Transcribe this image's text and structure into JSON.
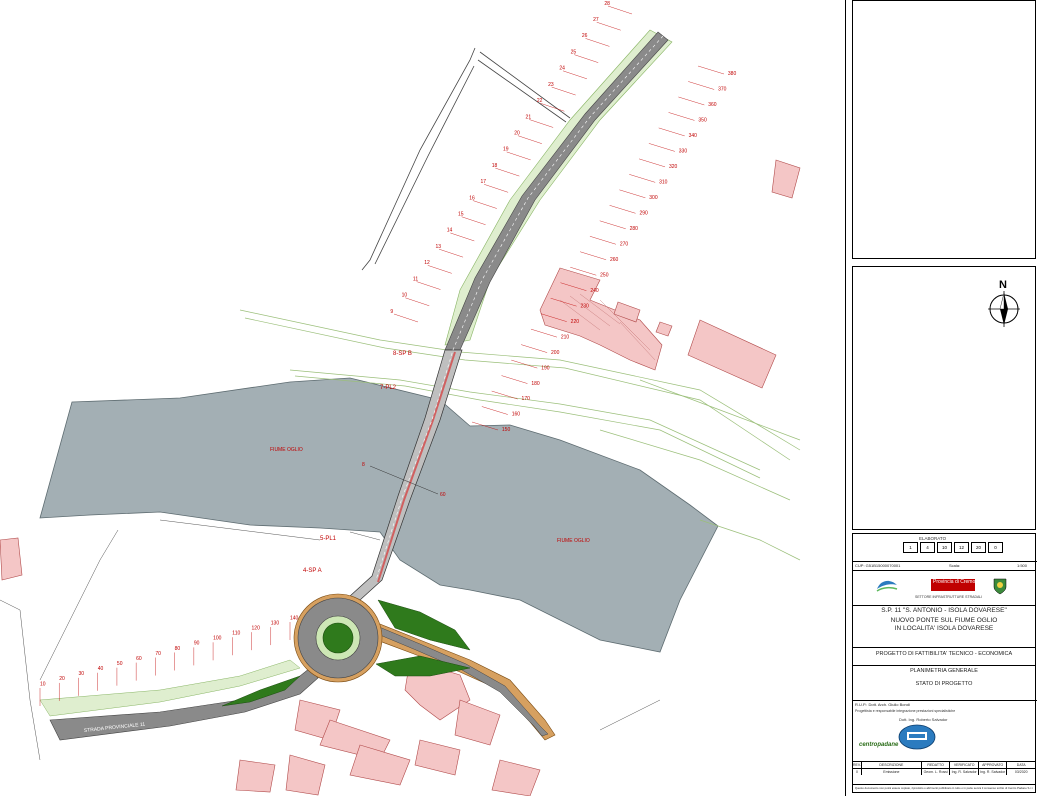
{
  "map": {
    "river_label_1": "FIUME OGLIO",
    "river_label_2": "FIUME OGLIO",
    "road_label": "STRADA PROVINCIALE 11",
    "section_labels": [
      "8-SP B",
      "7-PL2",
      "5-PL1",
      "4-SP A"
    ],
    "center_numbers": [
      "8",
      "60"
    ],
    "left_stations": [
      "28",
      "27",
      "26",
      "25",
      "24",
      "23",
      "22",
      "21",
      "20",
      "19",
      "18",
      "17",
      "16",
      "15",
      "14",
      "13",
      "12",
      "11",
      "10",
      "9"
    ],
    "right_stations": [
      "380",
      "370",
      "360",
      "350",
      "340",
      "330",
      "320",
      "310",
      "300",
      "290",
      "280",
      "270",
      "260",
      "250",
      "240",
      "230",
      "220",
      "210",
      "200",
      "190",
      "180",
      "170",
      "160",
      "150"
    ],
    "bottom_stations": [
      "10",
      "20",
      "30",
      "40",
      "50",
      "60",
      "70",
      "80",
      "90",
      "100",
      "110",
      "120",
      "130",
      "140"
    ]
  },
  "panel": {
    "north_label": "N",
    "sheet_header": "ELABORATO",
    "sheet_cells": [
      "1",
      "4",
      "10",
      "12",
      "20",
      "0"
    ],
    "cup_label": "CUP: G51B15000070001",
    "scale_label": "Scala:",
    "scale_value": "1:500",
    "logo_provincia": "Provincia di Cremona",
    "settore_text": "SETTORE INFRASTRUTTURE STRADALI",
    "road_title": "S.P. 11 \"S. ANTONIO - ISOLA DOVARESE\"",
    "project_title_1": "NUOVO PONTE SUL FIUME OGLIO",
    "project_title_2": "IN LOCALITA' ISOLA DOVARESE",
    "phase": "PROGETTO DI FATTIBILITA' TECNICO - ECONOMICA",
    "drawing_1": "PLANIMETRIA GENERALE",
    "drawing_2": "STATO DI PROGETTO",
    "rup": "R.U.P.: Dott. Arch. Giulio Bondi",
    "progettista": "Progettista e responsabile integrazione prestazioni specialistiche",
    "engineer": "Dott. Ing. Roberto Salvador",
    "company_logo": "centropadane",
    "table_headers": [
      "REV.",
      "DESCRIZIONE",
      "REDATTO",
      "VERIFICATO",
      "APPROVATO",
      "DATA"
    ],
    "table_row": [
      "0",
      "Emissione",
      "Geom. L. Rossi",
      "Ing. R. Salvador",
      "Ing. R. Salvador",
      "03/2020"
    ],
    "footer_note": "Questo documento non potrà essere copiato, riprodotto o altrimenti pubblicato in tutto o in parte senza il consenso scritto di Centro Padane S.r.l."
  },
  "colors": {
    "river": "#a3afb4",
    "road": "#8a8a8a",
    "green": "#2f7a1c",
    "building": "#f4c6c6",
    "red": "#c00000"
  }
}
